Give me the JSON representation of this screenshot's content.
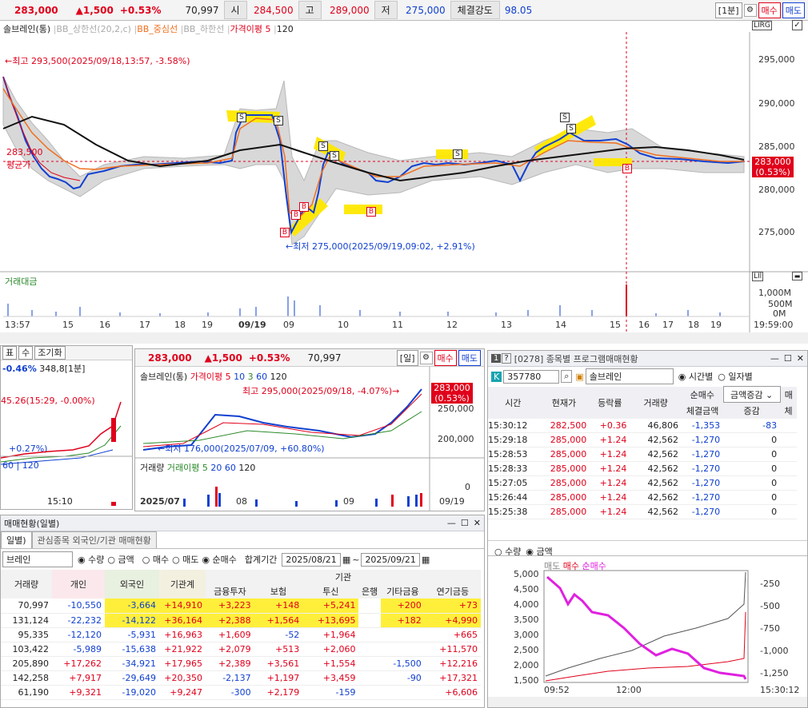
{
  "header": {
    "price": "283,000",
    "change": "▲1,500",
    "change_pct": "+0.53%",
    "volume": "70,997",
    "open_label": "시",
    "open": "284,500",
    "high_label": "고",
    "high": "289,000",
    "low_label": "저",
    "low": "275,000",
    "strength_label": "체결강도",
    "strength": "98.05",
    "interval": "[1분]",
    "sell": "매수",
    "buy": "매도"
  },
  "main_chart": {
    "legend": {
      "name": "솔브레인(통)",
      "bb_up": "BB_상한선(20,2,c)",
      "bb_mid": "BB_중심선",
      "bb_low": "BB_하한선",
      "avg": "가격이평 5",
      "ma": "120"
    },
    "high_note": "←최고 293,500(2025/09/18,13:57, -3.58%)",
    "low_note": "←최저 275,000(2025/09/19,09:02, +2.91%)",
    "avg_price": "283,500",
    "avg_label": "평균가",
    "cur_price": "283,000",
    "cur_pct": "(0.53%)",
    "yticks": [
      "295,000",
      "290,000",
      "285,000",
      "280,000",
      "275,000"
    ],
    "vol_label": "거래대금",
    "vol_ticks": [
      "1,000M",
      "500M",
      "0M"
    ],
    "xticks": [
      "13:57",
      "15",
      "16",
      "17",
      "18",
      "19",
      "09/19",
      "09",
      "10",
      "11",
      "12",
      "13",
      "14",
      "15",
      "16",
      "17",
      "18",
      "19"
    ],
    "time_end": "19:59:00",
    "markers": [
      {
        "t": "S"
      },
      {
        "t": "S"
      },
      {
        "t": "S"
      },
      {
        "t": "S"
      },
      {
        "t": "S"
      },
      {
        "t": "S"
      },
      {
        "t": "S"
      },
      {
        "t": "B"
      },
      {
        "t": "B"
      },
      {
        "t": "B"
      },
      {
        "t": "B"
      },
      {
        "t": "B"
      }
    ],
    "indicator_btn": "LIRG",
    "vol_btn": "LIl"
  },
  "left_small": {
    "pct": "-0.46%",
    "val": "348,8[1분]",
    "note": "45.26(15:29, -0.00%)",
    "note2": "+0.27%)",
    "legend": "60 | 120",
    "xlabel": "15:10",
    "tabs": [
      "표",
      "수",
      "조기화"
    ]
  },
  "mid_chart": {
    "price": "283,000",
    "change": "▲1,500",
    "pct": "+0.53%",
    "vol": "70,997",
    "interval": "[일]",
    "sell": "매수",
    "buy": "매도",
    "legend": {
      "name": "솔브레인(통)",
      "avg": "가격이평 5",
      "m10": "10",
      "m3": "3",
      "m60": "60",
      "m120": "120"
    },
    "high_note": "최고 295,000(2025/09/18, -4.07%)→",
    "low_note": "←최저 176,000(2025/07/09, +60.80%)",
    "cur": "283,000",
    "cur_pct": "(0.53%)",
    "yticks": [
      "250,000",
      "200,000"
    ],
    "vol_legend": {
      "vol": "거래량",
      "avg": "거래이평 5",
      "m20": "20",
      "m60": "60",
      "m120": "120"
    },
    "vol_tick": "0",
    "xticks": [
      "2025/07",
      "08",
      "09",
      "09/19"
    ]
  },
  "program": {
    "title": "[0278] 종목별 프로그램매매현황",
    "code": "357780",
    "name": "솔브레인",
    "radio1": "시간별",
    "radio2": "일자별",
    "cols": [
      "시간",
      "현재가",
      "등락률",
      "거래량",
      "순매수",
      "체결금액",
      "증감",
      "매",
      "체"
    ],
    "combo": "금액증감",
    "rows": [
      [
        "15:30:12",
        "282,500",
        "+0.36",
        "46,806",
        "-1,353",
        "-83"
      ],
      [
        "15:29:18",
        "285,000",
        "+1.24",
        "42,562",
        "-1,270",
        "0"
      ],
      [
        "15:28:53",
        "285,000",
        "+1.24",
        "42,562",
        "-1,270",
        "0"
      ],
      [
        "15:28:33",
        "285,000",
        "+1.24",
        "42,562",
        "-1,270",
        "0"
      ],
      [
        "15:27:05",
        "285,000",
        "+1.24",
        "42,562",
        "-1,270",
        "0"
      ],
      [
        "15:26:44",
        "285,000",
        "+1.24",
        "42,562",
        "-1,270",
        "0"
      ],
      [
        "15:25:38",
        "285,000",
        "+1.24",
        "42,562",
        "-1,270",
        "0"
      ]
    ],
    "radio_qty": "수량",
    "radio_amt": "금액",
    "legend": {
      "sell": "매도",
      "buy": "매수",
      "net": "순매수"
    },
    "yleft": [
      "5,000",
      "4,500",
      "4,000",
      "3,500",
      "3,000",
      "2,500",
      "2,000",
      "1,500"
    ],
    "yright": [
      "-250",
      "-500",
      "-750",
      "-1,000",
      "-1,250"
    ],
    "xticks": [
      "09:52",
      "12:00",
      "15:30:12"
    ]
  },
  "investor": {
    "title": "매매현황(일별)",
    "tab1": "일별)",
    "tab2": "관심종목 외국인/기관 매매현황",
    "stock": "브레인",
    "r_qty": "수량",
    "r_amt": "금액",
    "r_buy": "매수",
    "r_sell": "매도",
    "r_net": "순매수",
    "period_label": "합계기간",
    "date_from": "2025/08/21",
    "date_to": "2025/09/21",
    "cols": [
      "거래량",
      "개인",
      "외국인",
      "기관계",
      "금융투자",
      "보험",
      "투신",
      "은행",
      "기타금융",
      "연기금등"
    ],
    "group": "기관",
    "rows": [
      [
        "70,997",
        "-10,550",
        "-3,664",
        "+14,910",
        "+3,223",
        "+148",
        "+5,241",
        "",
        "+200",
        "+73"
      ],
      [
        "131,124",
        "-22,232",
        "-14,122",
        "+36,164",
        "+2,388",
        "+1,564",
        "+13,695",
        "",
        "+182",
        "+4,990"
      ],
      [
        "95,335",
        "-12,120",
        "-5,931",
        "+16,963",
        "+1,609",
        "-52",
        "+1,964",
        "",
        "",
        "+665"
      ],
      [
        "103,422",
        "-5,989",
        "-15,638",
        "+21,922",
        "+2,079",
        "+513",
        "+2,060",
        "",
        "",
        "+11,570"
      ],
      [
        "205,890",
        "+17,262",
        "-34,921",
        "+17,965",
        "+2,389",
        "+3,561",
        "+1,554",
        "",
        "-1,500",
        "+12,216"
      ],
      [
        "142,258",
        "+7,917",
        "-29,649",
        "+20,350",
        "-2,137",
        "+1,197",
        "+3,459",
        "",
        "-90",
        "+17,321"
      ],
      [
        "61,190",
        "+9,321",
        "-19,020",
        "+9,247",
        "-300",
        "+2,179",
        "-159",
        "",
        "",
        "+6,606"
      ]
    ]
  }
}
